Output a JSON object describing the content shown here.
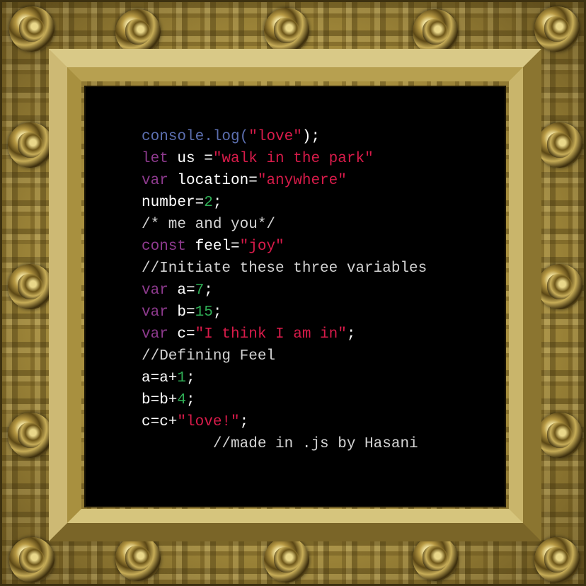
{
  "code_lines": [
    [
      {
        "t": "console.log(",
        "c": "fn"
      },
      {
        "t": "\"love\"",
        "c": "str"
      },
      {
        "t": ");",
        "c": "pl"
      }
    ],
    [
      {
        "t": "let",
        "c": "kw"
      },
      {
        "t": " us =",
        "c": "pl"
      },
      {
        "t": "\"walk in the park\"",
        "c": "str"
      }
    ],
    [
      {
        "t": "var",
        "c": "kw"
      },
      {
        "t": " location=",
        "c": "pl"
      },
      {
        "t": "\"anywhere\"",
        "c": "str"
      }
    ],
    [
      {
        "t": "number=",
        "c": "pl"
      },
      {
        "t": "2",
        "c": "num"
      },
      {
        "t": ";",
        "c": "pl"
      }
    ],
    [
      {
        "t": "/* me and you*/",
        "c": "cm"
      }
    ],
    [
      {
        "t": "const",
        "c": "kw"
      },
      {
        "t": " feel=",
        "c": "pl"
      },
      {
        "t": "\"joy\"",
        "c": "str"
      }
    ],
    [
      {
        "t": "//Initiate these three variables",
        "c": "cm"
      }
    ],
    [
      {
        "t": "var",
        "c": "kw"
      },
      {
        "t": " a=",
        "c": "pl"
      },
      {
        "t": "7",
        "c": "num"
      },
      {
        "t": ";",
        "c": "pl"
      }
    ],
    [
      {
        "t": "var",
        "c": "kw"
      },
      {
        "t": " b=",
        "c": "pl"
      },
      {
        "t": "15",
        "c": "num"
      },
      {
        "t": ";",
        "c": "pl"
      }
    ],
    [
      {
        "t": "var",
        "c": "kw"
      },
      {
        "t": " c=",
        "c": "pl"
      },
      {
        "t": "\"I think I am in\"",
        "c": "str"
      },
      {
        "t": ";",
        "c": "pl"
      }
    ],
    [
      {
        "t": "//Defining Feel",
        "c": "cm"
      }
    ],
    [
      {
        "t": "a=a+",
        "c": "pl"
      },
      {
        "t": "1",
        "c": "num"
      },
      {
        "t": ";",
        "c": "pl"
      }
    ],
    [
      {
        "t": "b=b+",
        "c": "pl"
      },
      {
        "t": "4",
        "c": "num"
      },
      {
        "t": ";",
        "c": "pl"
      }
    ],
    [
      {
        "t": "c=c+",
        "c": "pl"
      },
      {
        "t": "\"love!\"",
        "c": "str"
      },
      {
        "t": ";",
        "c": "pl"
      }
    ],
    [
      {
        "t": "        //made in .js by Hasani",
        "c": "cm"
      }
    ]
  ],
  "colors": {
    "function": "#5c6fb0",
    "keyword": "#8e3a8e",
    "string": "#d81b4a",
    "number": "#2fae55",
    "comment": "#d4d4d4",
    "plain": "#ffffff",
    "frame_gold": "#b89a44",
    "canvas": "#000000"
  },
  "icons": {
    "frame_ornament": "baroque-scroll-icon"
  }
}
